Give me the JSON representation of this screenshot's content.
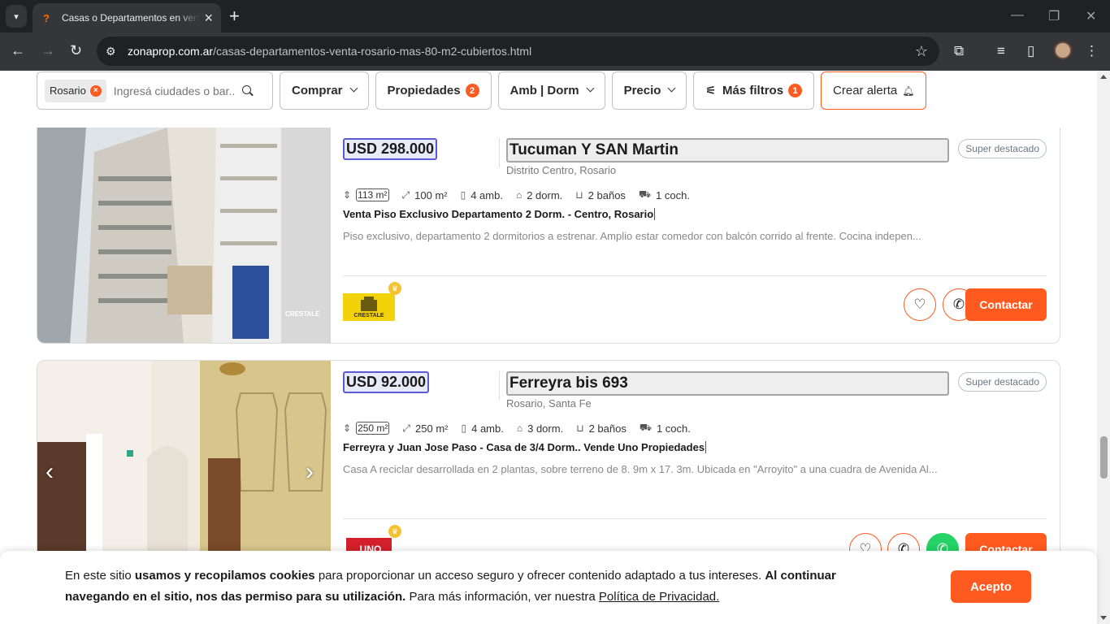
{
  "browser": {
    "tab_title": "Casas o Departamentos en venta",
    "url_host": "zonaprop.com.ar",
    "url_path": "/casas-departamentos-venta-rosario-mas-80-m2-cubiertos.html"
  },
  "filters": {
    "chip": "Rosario",
    "search_placeholder": "Ingresá ciudades o bar...",
    "comprar": "Comprar",
    "propiedades": "Propiedades",
    "propiedades_count": "2",
    "amb_dorm": "Amb | Dorm",
    "precio": "Precio",
    "mas_filtros": "Más filtros",
    "mas_filtros_count": "1",
    "crear_alerta": "Crear alerta"
  },
  "listings": [
    {
      "price": "USD 298.000",
      "address": "Tucuman Y SAN Martin",
      "location": "Distrito Centro, Rosario",
      "badge": "Super destacado",
      "features": [
        "113 m²",
        "100 m²",
        "4 amb.",
        "2 dorm.",
        "2 baños",
        "1 coch."
      ],
      "title": "Venta Piso Exclusivo Departamento 2 Dorm. - Centro, Rosario",
      "description": "Piso exclusivo, departamento 2 dormitorios a estrenar. Amplio estar comedor con balcón corrido al frente. Cocina indepen...",
      "contact": "Contactar",
      "logo_text": "CRESTALE"
    },
    {
      "price": "USD 92.000",
      "address": "Ferreyra bis 693",
      "location": "Rosario, Santa Fe",
      "badge": "Super destacado",
      "features": [
        "250 m²",
        "250 m²",
        "4 amb.",
        "3 dorm.",
        "2 baños",
        "1 coch."
      ],
      "title": "Ferreyra y Juan Jose Paso - Casa de 3/4 Dorm.. Vende Uno Propiedades",
      "description": "Casa A reciclar desarrollada en 2 plantas, sobre terreno de 8. 9m x 17. 3m. Ubicada en \"Arroyito\" a una cuadra de Avenida Al...",
      "contact": "Contactar",
      "logo_text": "UNO"
    }
  ],
  "cookie": {
    "t1": "En este sitio ",
    "b1": "usamos y recopilamos cookies",
    "t2": " para proporcionar un acceso seguro y ofrecer contenido adaptado a tus intereses. ",
    "b2": "Al continuar navegando en el sitio, nos das permiso para su utilización.",
    "t3": " Para más información, ver nuestra ",
    "link": "Política de Privacidad.",
    "accept": "Acepto"
  },
  "colors": {
    "brand": "#ff5a1f",
    "whatsapp": "#25d366"
  }
}
